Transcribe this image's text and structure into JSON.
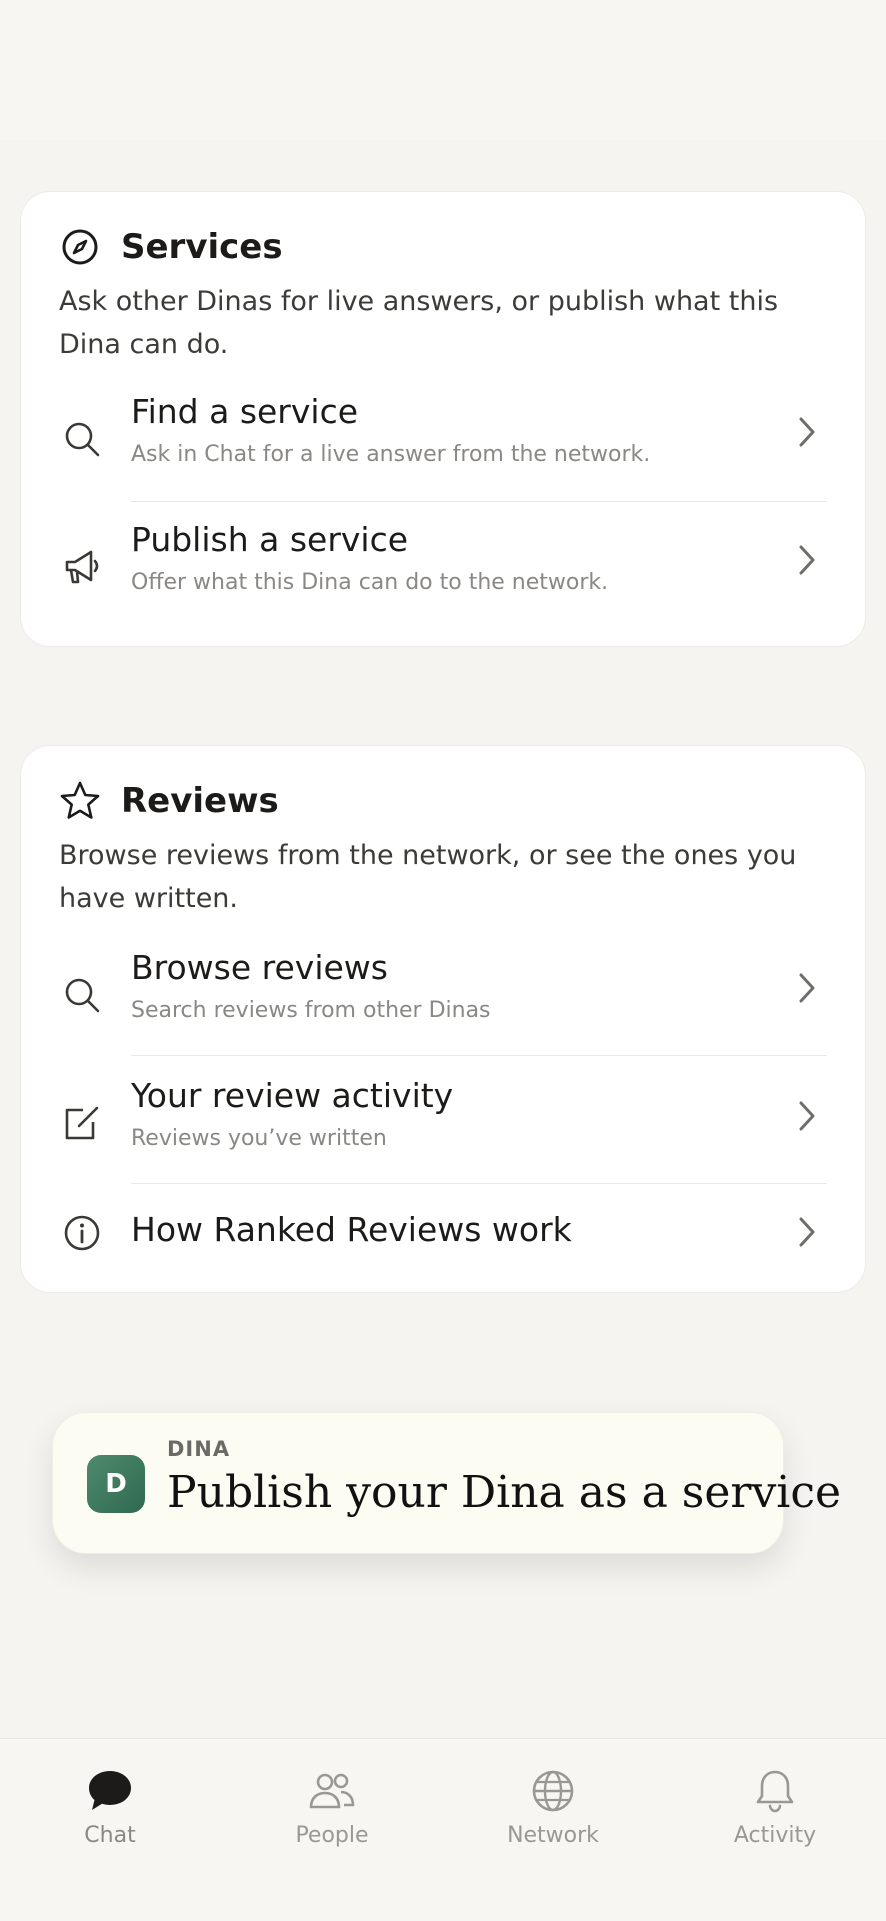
{
  "services": {
    "title": "Services",
    "description": "Ask other Dinas for live answers, or publish what this Dina can do.",
    "items": [
      {
        "title": "Find a service",
        "subtitle": "Ask in Chat for a live answer from the network.",
        "icon": "search-icon"
      },
      {
        "title": "Publish a service",
        "subtitle": "Offer what this Dina can do to the network.",
        "icon": "megaphone-icon"
      }
    ]
  },
  "reviews": {
    "title": "Reviews",
    "description": "Browse reviews from the network, or see the ones you have written.",
    "items": [
      {
        "title": "Browse reviews",
        "subtitle": "Search reviews from other Dinas",
        "icon": "search-icon"
      },
      {
        "title": "Your review activity",
        "subtitle": "Reviews you’ve written",
        "icon": "edit-icon"
      },
      {
        "title": "How Ranked Reviews work",
        "icon": "info-icon"
      }
    ]
  },
  "banner": {
    "avatar_letter": "D",
    "eyebrow": "DINA",
    "title": "Publish your Dina as a service"
  },
  "tabs": [
    {
      "label": "Chat",
      "icon": "chat-bubble-icon",
      "active": true
    },
    {
      "label": "People",
      "icon": "people-icon"
    },
    {
      "label": "Network",
      "icon": "globe-icon"
    },
    {
      "label": "Activity",
      "icon": "bell-icon"
    }
  ],
  "colors": {
    "background": "#f5f4f1",
    "card": "#ffffff",
    "accent_green": "#3d7a5e",
    "banner_bg": "#fdfcf3"
  }
}
